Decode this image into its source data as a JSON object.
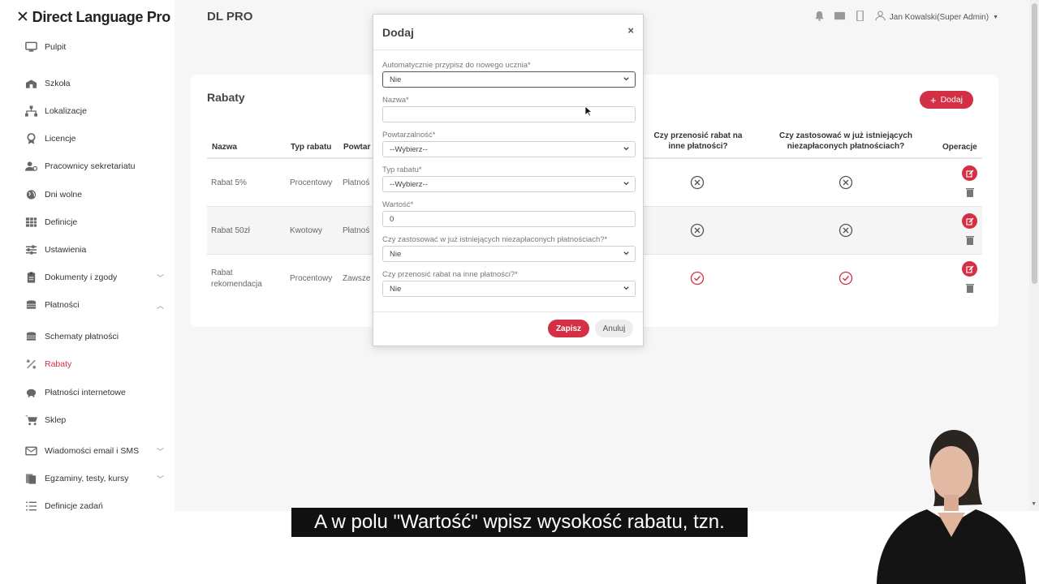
{
  "app": {
    "logo": "Direct Language Pro",
    "brand_title": "DL PRO",
    "user": "Jan Kowalski(Super Admin)"
  },
  "sidebar": {
    "items": [
      {
        "label": "Pulpit",
        "icon": "monitor-icon"
      },
      {
        "label": "Szkoła",
        "icon": "school-icon"
      },
      {
        "label": "Lokalizacje",
        "icon": "sitemap-icon"
      },
      {
        "label": "Licencje",
        "icon": "award-icon"
      },
      {
        "label": "Pracownicy sekretariatu",
        "icon": "users-cog-icon"
      },
      {
        "label": "Dni wolne",
        "icon": "globe-icon"
      },
      {
        "label": "Definicje",
        "icon": "table-icon"
      },
      {
        "label": "Ustawienia",
        "icon": "sliders-icon"
      },
      {
        "label": "Dokumenty i zgody",
        "icon": "clipboard-icon"
      },
      {
        "label": "Płatności",
        "icon": "coins-icon"
      },
      {
        "label": "Schematy płatności",
        "icon": "coins-icon"
      },
      {
        "label": "Rabaty",
        "icon": "percent-icon"
      },
      {
        "label": "Płatności internetowe",
        "icon": "piggy-bank-icon"
      },
      {
        "label": "Sklep",
        "icon": "cart-icon"
      },
      {
        "label": "Wiadomości email i SMS",
        "icon": "envelope-icon"
      },
      {
        "label": "Egzaminy, testy, kursy",
        "icon": "files-icon"
      },
      {
        "label": "Definicje zadań",
        "icon": "list-icon"
      }
    ]
  },
  "card": {
    "title": "Rabaty",
    "add_label": "Dodaj",
    "headers": {
      "name": "Nazwa",
      "type": "Typ rabatu",
      "repeat": "Powtar",
      "transfer": "Czy przenosić rabat na inne płatności?",
      "apply": "Czy zastosować w już istniejących niezapłaconych płatnościach?",
      "ops": "Operacje"
    },
    "rows": [
      {
        "name": "Rabat 5%",
        "type": "Procentowy",
        "repeat": "Płatnoś",
        "transfer": "no",
        "apply": "no"
      },
      {
        "name": "Rabat 50zł",
        "type": "Kwotowy",
        "repeat": "Płatnoś",
        "transfer": "no",
        "apply": "no"
      },
      {
        "name": "Rabat rekomendacja",
        "type": "Procentowy",
        "repeat": "Zawsze",
        "transfer": "yes",
        "apply": "yes"
      }
    ]
  },
  "modal": {
    "title": "Dodaj",
    "close": "×",
    "fields": [
      {
        "label": "Automatycznie przypisz do nowego ucznia*",
        "value": "Nie",
        "kind": "select"
      },
      {
        "label": "Nazwa*",
        "value": "",
        "kind": "input"
      },
      {
        "label": "Powtarzalność*",
        "value": "--Wybierz--",
        "kind": "select"
      },
      {
        "label": "Typ rabatu*",
        "value": "--Wybierz--",
        "kind": "select"
      },
      {
        "label": "Wartość*",
        "value": "0",
        "kind": "input"
      },
      {
        "label": "Czy zastosować w już istniejących niezapłaconych płatnościach?*",
        "value": "Nie",
        "kind": "select"
      },
      {
        "label": "Czy przenosić rabat na inne płatności?*",
        "value": "Nie",
        "kind": "select"
      }
    ],
    "save_label": "Zapisz",
    "cancel_label": "Anuluj"
  },
  "subtitle": "A w polu \"Wartość\" wpisz wysokość rabatu, tzn.",
  "colors": {
    "accent": "#d32f45"
  }
}
